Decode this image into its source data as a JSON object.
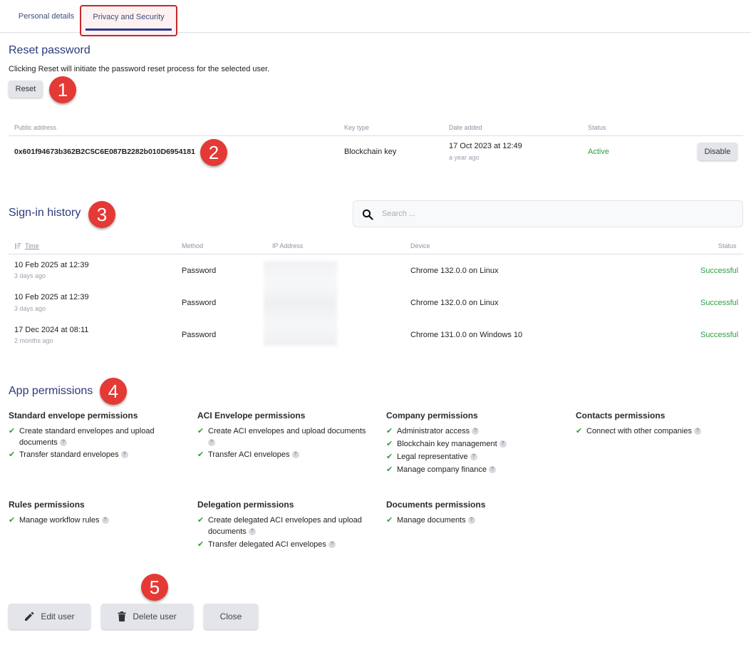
{
  "tabs": {
    "personal": "Personal details",
    "privacy": "Privacy and Security"
  },
  "reset": {
    "title": "Reset password",
    "description": "Clicking Reset will initiate the password reset process for the selected user.",
    "button": "Reset"
  },
  "keys": {
    "headers": {
      "address": "Public address",
      "type": "Key type",
      "date": "Date added",
      "status": "Status"
    },
    "row": {
      "address": "0x601f94673b362B2C5C6E087B2282b010D6954181",
      "type": "Blockchain key",
      "date": "17 Oct 2023 at 12:49",
      "relative": "a year ago",
      "status": "Active",
      "action": "Disable"
    }
  },
  "history": {
    "title": "Sign-in history",
    "search_placeholder": "Search ...",
    "headers": {
      "time": "Time",
      "method": "Method",
      "ip": "IP Address",
      "device": "Device",
      "status": "Status"
    },
    "rows": [
      {
        "time": "10 Feb 2025 at 12:39",
        "relative": "3 days ago",
        "method": "Password",
        "device": "Chrome 132.0.0 on Linux",
        "status": "Successful"
      },
      {
        "time": "10 Feb 2025 at 12:39",
        "relative": "3 days ago",
        "method": "Password",
        "device": "Chrome 132.0.0 on Linux",
        "status": "Successful"
      },
      {
        "time": "17 Dec 2024 at 08:11",
        "relative": "2 months ago",
        "method": "Password",
        "device": "Chrome 131.0.0 on Windows 10",
        "status": "Successful"
      }
    ]
  },
  "permissions": {
    "title": "App permissions",
    "groups": [
      {
        "title": "Standard envelope permissions",
        "items": [
          "Create standard envelopes and upload documents",
          "Transfer standard envelopes"
        ]
      },
      {
        "title": "ACI Envelope permissions",
        "items": [
          "Create ACI envelopes and upload documents",
          "Transfer ACI envelopes"
        ]
      },
      {
        "title": "Company permissions",
        "items": [
          "Administrator access",
          "Blockchain key management",
          "Legal representative",
          "Manage company finance"
        ]
      },
      {
        "title": "Contacts permissions",
        "items": [
          "Connect with other companies"
        ]
      },
      {
        "title": "Rules permissions",
        "items": [
          "Manage workflow rules"
        ]
      },
      {
        "title": "Delegation permissions",
        "items": [
          "Create delegated ACI envelopes and upload documents",
          "Transfer delegated ACI envelopes"
        ]
      },
      {
        "title": "Documents permissions",
        "items": [
          "Manage documents"
        ]
      }
    ]
  },
  "footer": {
    "edit": "Edit user",
    "delete": "Delete user",
    "close": "Close"
  },
  "markers": [
    "1",
    "2",
    "3",
    "4",
    "5"
  ],
  "icons": {
    "search": "search-icon",
    "sort": "sort-icon",
    "check": "check-icon",
    "help": "help-icon",
    "pencil": "pencil-icon",
    "trash": "trash-icon"
  },
  "colors": {
    "accent": "#2b3a7a",
    "success": "#2e9e3c",
    "marker": "#e53935"
  }
}
